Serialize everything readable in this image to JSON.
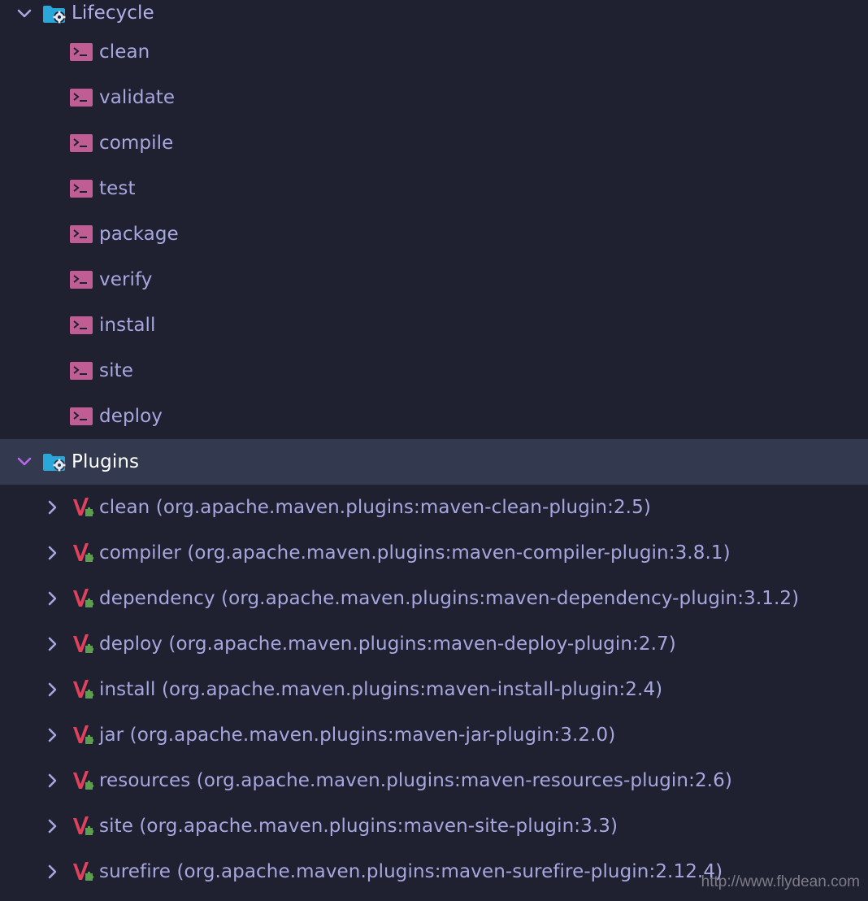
{
  "tree": {
    "lifecycle": {
      "label": "Lifecycle",
      "expanded": true,
      "icon": "folder-gear-icon",
      "items": [
        {
          "label": "clean",
          "icon": "terminal-icon"
        },
        {
          "label": "validate",
          "icon": "terminal-icon"
        },
        {
          "label": "compile",
          "icon": "terminal-icon"
        },
        {
          "label": "test",
          "icon": "terminal-icon"
        },
        {
          "label": "package",
          "icon": "terminal-icon"
        },
        {
          "label": "verify",
          "icon": "terminal-icon"
        },
        {
          "label": "install",
          "icon": "terminal-icon"
        },
        {
          "label": "site",
          "icon": "terminal-icon"
        },
        {
          "label": "deploy",
          "icon": "terminal-icon"
        }
      ]
    },
    "plugins": {
      "label": "Plugins",
      "expanded": true,
      "selected": true,
      "icon": "folder-gear-icon",
      "items": [
        {
          "label": "clean (org.apache.maven.plugins:maven-clean-plugin:2.5)",
          "icon": "maven-plugin-icon"
        },
        {
          "label": "compiler (org.apache.maven.plugins:maven-compiler-plugin:3.8.1)",
          "icon": "maven-plugin-icon"
        },
        {
          "label": "dependency (org.apache.maven.plugins:maven-dependency-plugin:3.1.2)",
          "icon": "maven-plugin-icon"
        },
        {
          "label": "deploy (org.apache.maven.plugins:maven-deploy-plugin:2.7)",
          "icon": "maven-plugin-icon"
        },
        {
          "label": "install (org.apache.maven.plugins:maven-install-plugin:2.4)",
          "icon": "maven-plugin-icon"
        },
        {
          "label": "jar (org.apache.maven.plugins:maven-jar-plugin:3.2.0)",
          "icon": "maven-plugin-icon"
        },
        {
          "label": "resources (org.apache.maven.plugins:maven-resources-plugin:2.6)",
          "icon": "maven-plugin-icon"
        },
        {
          "label": "site (org.apache.maven.plugins:maven-site-plugin:3.3)",
          "icon": "maven-plugin-icon"
        },
        {
          "label": "surefire (org.apache.maven.plugins:maven-surefire-plugin:2.12.4)",
          "icon": "maven-plugin-icon"
        }
      ]
    }
  },
  "watermark": "http://www.flydean.com",
  "colors": {
    "background": "#1f2130",
    "selected_row": "#333a50",
    "text": "#a8a6df",
    "folder_icon": "#28a7d8",
    "terminal_icon": "#c05d94",
    "plugin_icon": "#e0415c",
    "chevron": "#a8a6df",
    "chevron_selected": "#b768e6"
  }
}
